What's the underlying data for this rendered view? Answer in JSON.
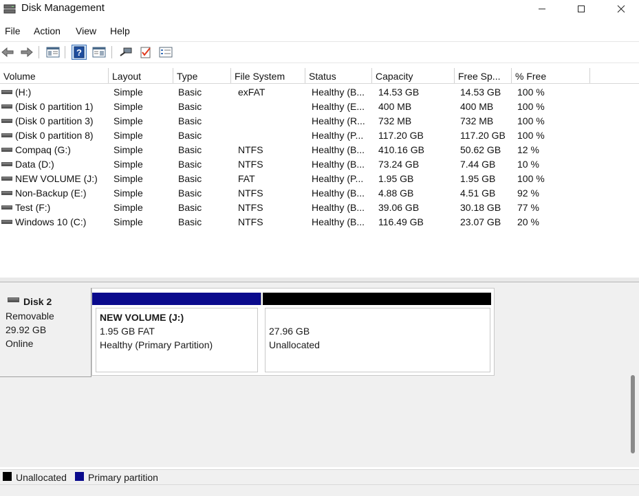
{
  "window": {
    "title": "Disk Management"
  },
  "menu": [
    "File",
    "Action",
    "View",
    "Help"
  ],
  "toolbar_icons": [
    "back-arrow-icon",
    "forward-arrow-icon",
    "console-tree-icon",
    "help-icon",
    "show-hide-pane-icon",
    "connect-icon",
    "properties-check-icon",
    "list-view-icon"
  ],
  "columns": [
    "Volume",
    "Layout",
    "Type",
    "File System",
    "Status",
    "Capacity",
    "Free Sp...",
    "% Free"
  ],
  "volumes": [
    [
      "(H:)",
      "Simple",
      "Basic",
      "exFAT",
      "Healthy (B...",
      "14.53 GB",
      "14.53 GB",
      "100 %"
    ],
    [
      "(Disk 0 partition 1)",
      "Simple",
      "Basic",
      "",
      "Healthy (E...",
      "400 MB",
      "400 MB",
      "100 %"
    ],
    [
      "(Disk 0 partition 3)",
      "Simple",
      "Basic",
      "",
      "Healthy (R...",
      "732 MB",
      "732 MB",
      "100 %"
    ],
    [
      "(Disk 0 partition 8)",
      "Simple",
      "Basic",
      "",
      "Healthy (P...",
      "117.20 GB",
      "117.20 GB",
      "100 %"
    ],
    [
      "Compaq (G:)",
      "Simple",
      "Basic",
      "NTFS",
      "Healthy (B...",
      "410.16 GB",
      "50.62 GB",
      "12 %"
    ],
    [
      "Data (D:)",
      "Simple",
      "Basic",
      "NTFS",
      "Healthy (B...",
      "73.24 GB",
      "7.44 GB",
      "10 %"
    ],
    [
      "NEW VOLUME (J:)",
      "Simple",
      "Basic",
      "FAT",
      "Healthy (P...",
      "1.95 GB",
      "1.95 GB",
      "100 %"
    ],
    [
      "Non-Backup (E:)",
      "Simple",
      "Basic",
      "NTFS",
      "Healthy (B...",
      "4.88 GB",
      "4.51 GB",
      "92 %"
    ],
    [
      "Test (F:)",
      "Simple",
      "Basic",
      "NTFS",
      "Healthy (B...",
      "39.06 GB",
      "30.18 GB",
      "77 %"
    ],
    [
      "Windows 10 (C:)",
      "Simple",
      "Basic",
      "NTFS",
      "Healthy (B...",
      "116.49 GB",
      "23.07 GB",
      "20 %"
    ]
  ],
  "disk": {
    "name": "Disk 2",
    "type": "Removable",
    "size": "29.92 GB",
    "state": "Online",
    "partitions": [
      {
        "title": "NEW VOLUME  (J:)",
        "line1": "1.95 GB FAT",
        "line2": "Healthy (Primary Partition)",
        "bar_color": "#0a0a8c"
      },
      {
        "title": "",
        "line1": "27.96 GB",
        "line2": "Unallocated",
        "bar_color": "#000000"
      }
    ]
  },
  "legend": [
    {
      "label": "Unallocated",
      "color": "#000000"
    },
    {
      "label": "Primary partition",
      "color": "#0a0a8c"
    }
  ]
}
